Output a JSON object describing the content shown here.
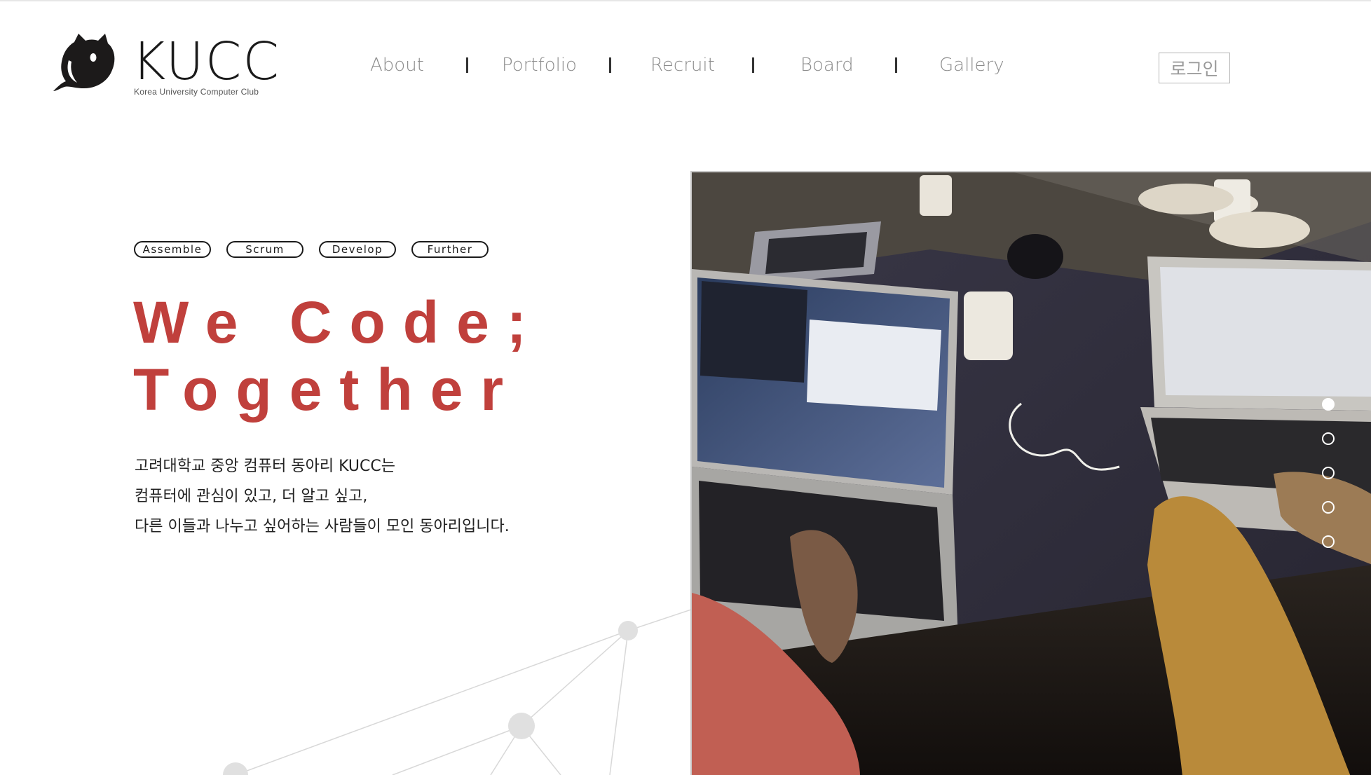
{
  "logo": {
    "wordmark": "KUCC",
    "subtitle": "Korea University Computer Club"
  },
  "nav": {
    "items": [
      "About",
      "Portfolio",
      "Recruit",
      "Board",
      "Gallery"
    ],
    "login_label": "로그인"
  },
  "hero": {
    "tags": [
      "Assemble",
      "Scrum",
      "Develop",
      "Further"
    ],
    "headline_line1": "We Code;",
    "headline_line2": "Together",
    "description": [
      "고려대학교 중앙 컴퓨터 동아리 KUCC는",
      "컴퓨터에 관심이 있고, 더 알고 싶고,",
      "다른 이들과 나누고 싶어하는 사람들이 모인 동아리입니다."
    ],
    "accent_color": "#c0403c"
  },
  "slider": {
    "slide_count": 5,
    "active_index": 0
  },
  "icons": {
    "logo": "cat-logo-icon"
  }
}
